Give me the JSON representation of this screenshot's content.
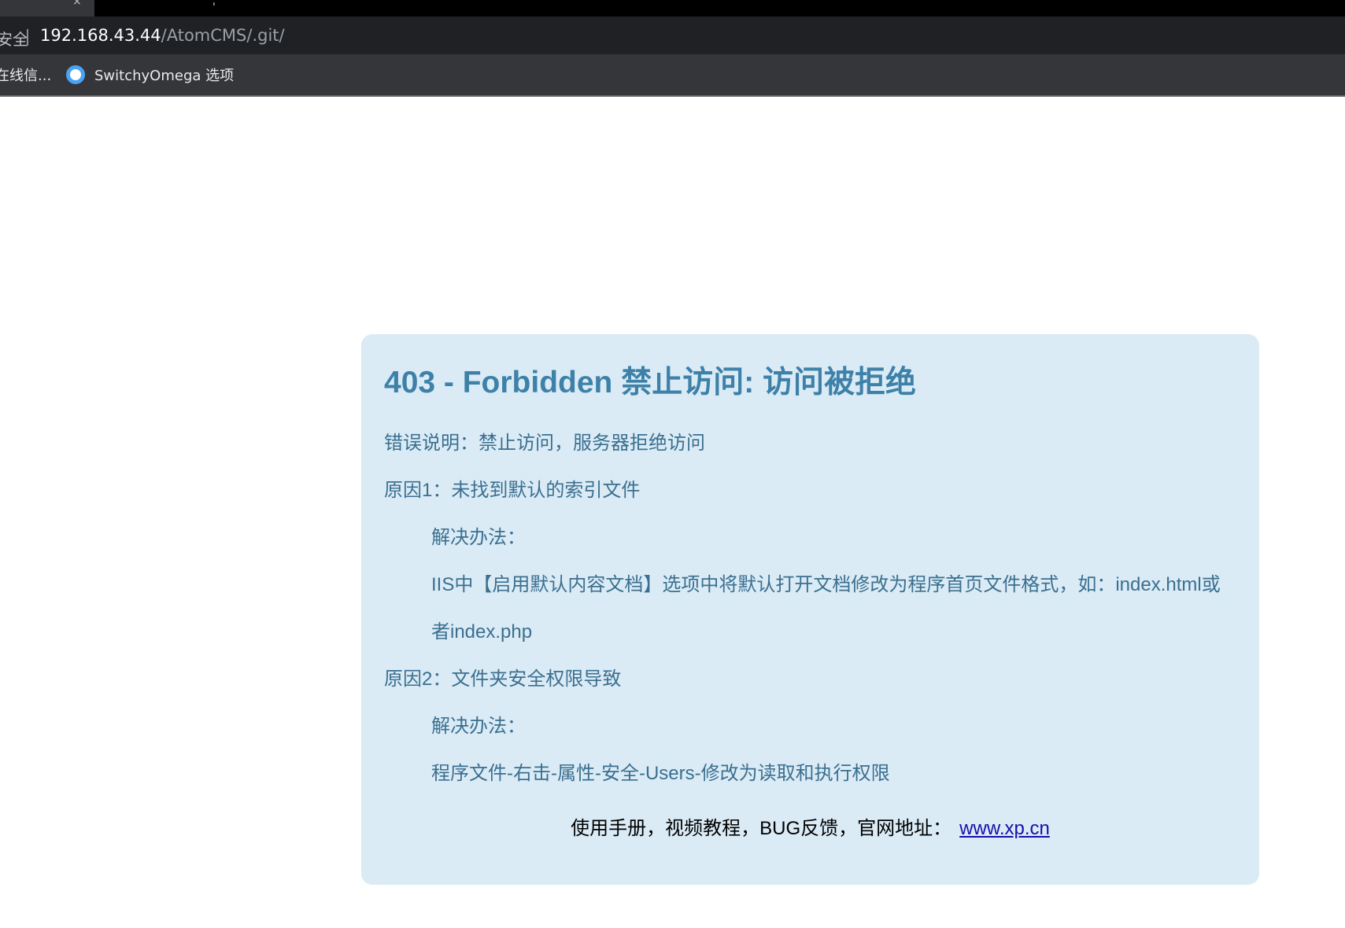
{
  "browser": {
    "address": {
      "security_label": "安全",
      "url_host": "192.168.43.44",
      "url_path": "/AtomCMS/.git/"
    },
    "bookmarks": [
      {
        "label": "在线信...",
        "icon": "none"
      },
      {
        "label": "SwitchyOmega 选项",
        "icon": "switchyomega-circle-icon"
      }
    ]
  },
  "page": {
    "title": "403 - Forbidden 禁止访问: 访问被拒绝",
    "lines": [
      "错误说明：禁止访问，服务器拒绝访问",
      "原因1：未找到默认的索引文件",
      "解决办法：",
      "IIS中【启用默认内容文档】选项中将默认打开文档修改为程序首页文件格式，如：index.html或",
      "者index.php",
      "原因2：文件夹安全权限导致",
      "解决办法：",
      "程序文件-右击-属性-安全-Users-修改为读取和执行权限"
    ],
    "footer_text": "使用手册，视频教程，BUG反馈，官网地址：",
    "footer_link": "www.xp.cn"
  },
  "colors": {
    "box_background": "#daebf6",
    "title": "#3e81a8",
    "body_text": "#3b6f8f",
    "link": "#1a0dab"
  }
}
